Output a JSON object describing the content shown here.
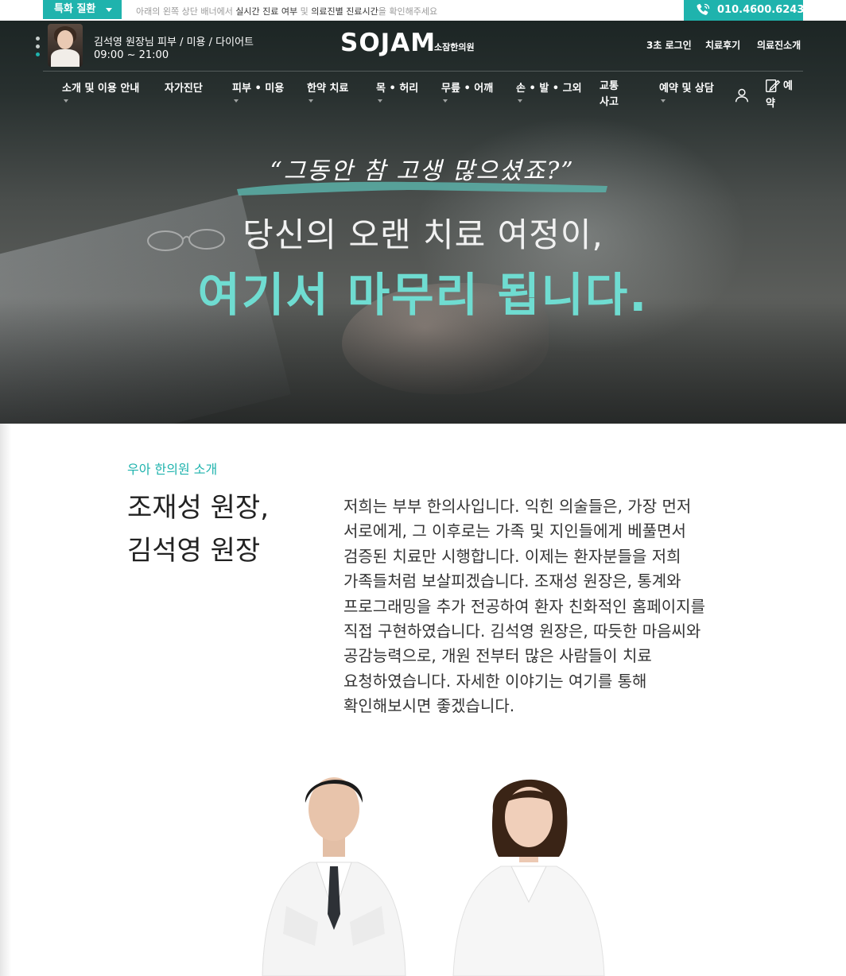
{
  "topbar": {
    "specialty_label": "특화 질환",
    "notice_pre": "아래의 왼쪽 상단 배너에서 ",
    "notice_b1": "실시간 진료 여부",
    "notice_mid": " 및 ",
    "notice_b2": "의료진별 진료시간",
    "notice_post": "을 확인해주세요",
    "phone": "010.4600.6243"
  },
  "header": {
    "doctor_name": "김석영 원장님  피부 / 미용 / 다이어트",
    "doctor_hours": "09:00 ~ 21:00",
    "logo_mark": "SOJAM",
    "logo_sub": "소잠한의원",
    "util_links": [
      "3초 로그인",
      "치료후기",
      "의료진소개"
    ]
  },
  "nav": {
    "items": [
      {
        "label": "소개 및 이용 안내"
      },
      {
        "label": "자가진단"
      },
      {
        "label": "피부 • 미용"
      },
      {
        "label": "한약 치료"
      },
      {
        "label": "목 • 허리"
      },
      {
        "label": "무릎 • 어깨"
      },
      {
        "label": "손 • 발 • 그외"
      },
      {
        "label": "교통사고"
      },
      {
        "label": "예약 및 상담"
      }
    ],
    "reserve_1": "예",
    "reserve_2": "약"
  },
  "hero": {
    "quote": "“그동안 참 고생 많으셨죠?”",
    "line1": "당신의 오랜 치료 여정이,",
    "line2": "여기서 마무리 됩니다."
  },
  "intro": {
    "eyebrow": "우아 한의원 소개",
    "title_1": "조재성 원장,",
    "title_2": "김석영 원장",
    "body": "저희는 부부 한의사입니다. 익힌 의술들은, 가장 먼저 서로에게, 그 이후로는 가족 및 지인들에게 베풀면서 검증된 치료만 시행합니다. 이제는 환자분들을 저희 가족들처럼 보살피겠습니다. 조재성 원장은, 통계와 프로그래밍을 추가 전공하여 환자 친화적인 홈페이지를 직접 구현하였습니다. 김석영 원장은, 따듯한 마음씨와 공감능력으로, 개원 전부터 많은 사람들이 치료 요청하였습니다. 자세한 이야기는 여기를 통해 확인해보시면 좋겠습니다."
  },
  "colors": {
    "accent": "#1fb3ad",
    "hero_highlight": "#6fdcd1"
  },
  "icons": [
    "caret-down-icon",
    "phone-icon",
    "menu-dots-icon",
    "user-icon",
    "edit-note-icon",
    "glasses-icon"
  ]
}
